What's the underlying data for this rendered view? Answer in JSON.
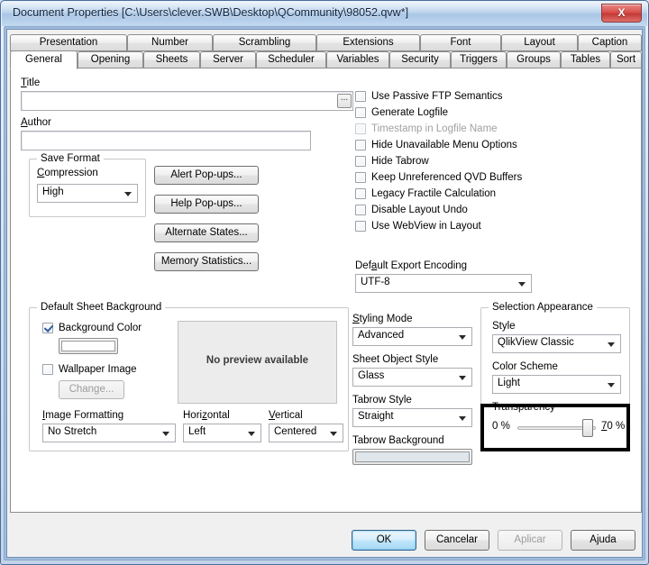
{
  "window": {
    "title": "Document Properties [C:\\Users\\clever.SWB\\Desktop\\QCommunity\\98052.qvw*]",
    "close_label": "X"
  },
  "tabs": {
    "row1": [
      {
        "label": "Presentation"
      },
      {
        "label": "Number"
      },
      {
        "label": "Scrambling"
      },
      {
        "label": "Extensions"
      },
      {
        "label": "Font"
      },
      {
        "label": "Layout"
      },
      {
        "label": "Caption"
      }
    ],
    "row2": [
      {
        "label": "General",
        "active": true
      },
      {
        "label": "Opening"
      },
      {
        "label": "Sheets"
      },
      {
        "label": "Server"
      },
      {
        "label": "Scheduler"
      },
      {
        "label": "Variables"
      },
      {
        "label": "Security"
      },
      {
        "label": "Triggers"
      },
      {
        "label": "Groups"
      },
      {
        "label": "Tables"
      },
      {
        "label": "Sort"
      }
    ]
  },
  "general": {
    "title_label": "Title",
    "title_value": "",
    "title_browse_label": "...",
    "author_label": "Author",
    "author_value": "",
    "save_format": {
      "group_label": "Save Format",
      "compression_label": "Compression",
      "compression_value": "High"
    },
    "buttons": {
      "alert_popups": "Alert Pop-ups...",
      "help_popups": "Help Pop-ups...",
      "alternate_states": "Alternate States...",
      "memory_statistics": "Memory Statistics..."
    },
    "checkboxes": [
      {
        "label": "Use Passive FTP Semantics",
        "checked": false,
        "disabled": false
      },
      {
        "label": "Generate Logfile",
        "checked": false,
        "disabled": false
      },
      {
        "label": "Timestamp in Logfile Name",
        "checked": false,
        "disabled": true
      },
      {
        "label": "Hide Unavailable Menu Options",
        "checked": false,
        "disabled": false
      },
      {
        "label": "Hide Tabrow",
        "checked": false,
        "disabled": false
      },
      {
        "label": "Keep Unreferenced QVD Buffers",
        "checked": false,
        "disabled": false
      },
      {
        "label": "Legacy Fractile Calculation",
        "checked": false,
        "disabled": false
      },
      {
        "label": "Disable Layout Undo",
        "checked": false,
        "disabled": false
      },
      {
        "label": "Use WebView in Layout",
        "checked": false,
        "disabled": false
      }
    ],
    "export_encoding": {
      "label": "Default Export Encoding",
      "value": "UTF-8"
    }
  },
  "sheet_background": {
    "group_label": "Default Sheet Background",
    "background_color": {
      "label": "Background Color",
      "checked": true,
      "swatch_color": "#ffffff"
    },
    "wallpaper_image": {
      "label": "Wallpaper Image",
      "checked": false
    },
    "change_button": "Change...",
    "preview_text": "No preview available",
    "image_formatting": {
      "label": "Image Formatting",
      "value": "No Stretch"
    },
    "horizontal": {
      "label": "Horizontal",
      "value": "Left"
    },
    "vertical": {
      "label": "Vertical",
      "value": "Centered"
    }
  },
  "styling": {
    "styling_mode": {
      "label": "Styling Mode",
      "value": "Advanced"
    },
    "sheet_object_style": {
      "label": "Sheet Object Style",
      "value": "Glass"
    },
    "tabrow_style": {
      "label": "Tabrow Style",
      "value": "Straight"
    },
    "tabrow_background": {
      "label": "Tabrow Background",
      "swatch_color": "#dfe6ec"
    }
  },
  "selection_appearance": {
    "group_label": "Selection Appearance",
    "style": {
      "label": "Style",
      "value": "QlikView Classic"
    },
    "color_scheme": {
      "label": "Color Scheme",
      "value": "Light"
    },
    "transparency": {
      "label": "Transparency",
      "min_label": "0 %",
      "max_label": "70 %",
      "value_percent": 70,
      "thumb_position_percent": 82
    }
  },
  "footer": {
    "ok": "OK",
    "cancel": "Cancelar",
    "apply": "Aplicar",
    "help": "Ajuda"
  },
  "colors": {
    "accent": "#2c628b",
    "highlight_box": "#000000",
    "panel_bg": "#ffffff",
    "dialog_bg": "#f0f0f0"
  }
}
